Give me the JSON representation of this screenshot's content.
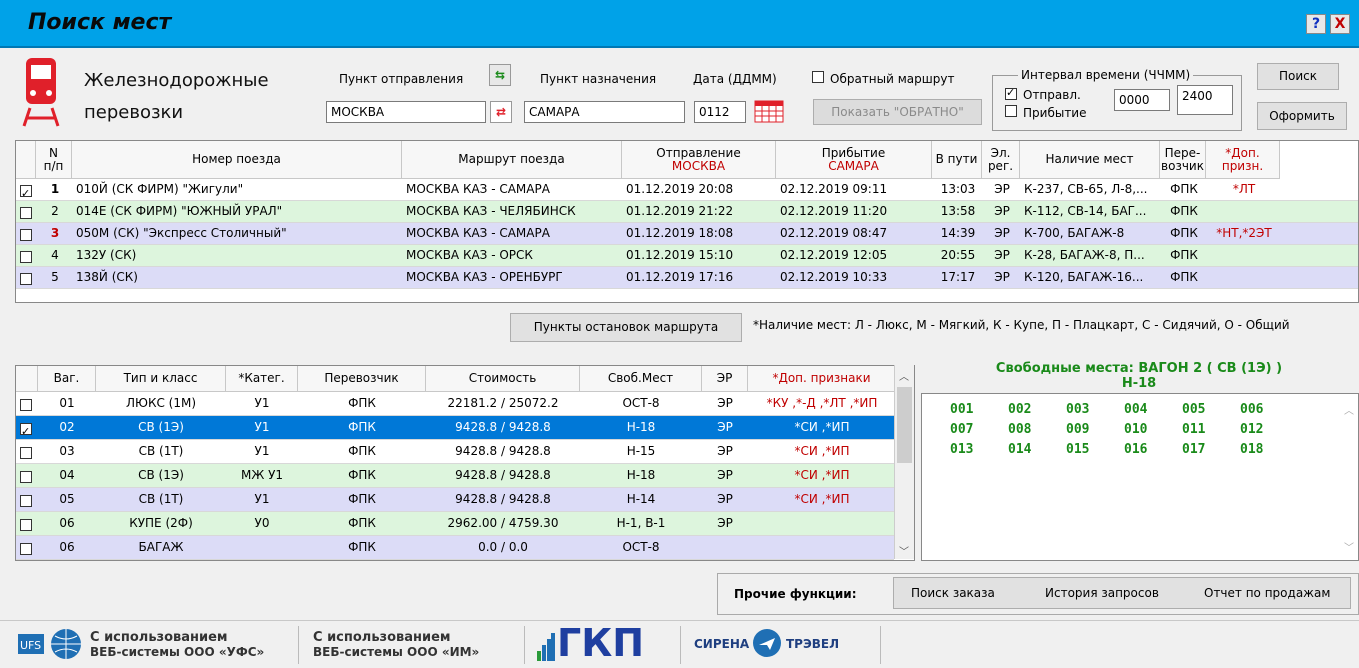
{
  "window": {
    "title": "Поиск мест",
    "help_label": "?",
    "close_label": "X"
  },
  "brand": {
    "line1": "Железнодорожные",
    "line2": "перевозки"
  },
  "search": {
    "from_label": "Пункт отправления",
    "from_value": "МОСКВА",
    "to_label": "Пункт назначения",
    "to_value": "САМАРА",
    "date_label": "Дата (ДДММ)",
    "date_value": "0112",
    "return_label": "Обратный маршрут",
    "show_return_label": "Показать \"ОБРАТНО\"",
    "interval_title": "Интервал времени (ЧЧММ)",
    "depart_label": "Отправл.",
    "arrive_label": "Прибытие",
    "time_from": "0000",
    "time_to": "2400",
    "search_button": "Поиск",
    "order_button": "Оформить"
  },
  "trains": {
    "headers": [
      {
        "l1": "N",
        "l2": "п/п"
      },
      {
        "l1": "Номер поезда",
        "l2": ""
      },
      {
        "l1": "Маршрут поезда",
        "l2": ""
      },
      {
        "l1": "Отправление",
        "l2": "МОСКВА"
      },
      {
        "l1": "Прибытие",
        "l2": "САМАРА"
      },
      {
        "l1": "В пути",
        "l2": ""
      },
      {
        "l1": "Эл.",
        "l2": "рег."
      },
      {
        "l1": "Наличие мест",
        "l2": ""
      },
      {
        "l1": "Пере-",
        "l2": "возчик"
      },
      {
        "l1": "*Доп.",
        "l2": "призн."
      }
    ],
    "rows": [
      {
        "n": "1",
        "train": "010Й  (СК ФИРМ)  \"Жигули\"",
        "route": "МОСКВА КАЗ - САМАРА",
        "dep": "01.12.2019  20:08",
        "arr": "02.12.2019  09:11",
        "dur": "13:03",
        "er": "ЭР",
        "seats": "К-237, СВ-65, Л-8,...",
        "carrier": "ФПК",
        "extra": "*ЛТ",
        "checked": true,
        "bold": true,
        "red_n": false,
        "bg": "#ffffff"
      },
      {
        "n": "2",
        "train": "014Е  (СК ФИРМ)  \"ЮЖНЫЙ УРАЛ\"",
        "route": "МОСКВА КАЗ - ЧЕЛЯБИНСК",
        "dep": "01.12.2019  21:22",
        "arr": "02.12.2019  11:20",
        "dur": "13:58",
        "er": "ЭР",
        "seats": "К-112, СВ-14, БАГ...",
        "carrier": "ФПК",
        "extra": "",
        "checked": false,
        "bold": false,
        "red_n": false,
        "bg": "#ddf5dd"
      },
      {
        "n": "3",
        "train": "050М  (СК)  \"Экспресс Столичный\"",
        "route": "МОСКВА КАЗ - САМАРА",
        "dep": "01.12.2019  18:08",
        "arr": "02.12.2019  08:47",
        "dur": "14:39",
        "er": "ЭР",
        "seats": "К-700, БАГАЖ-8",
        "carrier": "ФПК",
        "extra": "*НТ,*2ЭТ",
        "checked": false,
        "bold": true,
        "red_n": true,
        "bg": "#dcdcf7"
      },
      {
        "n": "4",
        "train": "132У  (СК)",
        "route": "МОСКВА КАЗ - ОРСК",
        "dep": "01.12.2019  15:10",
        "arr": "02.12.2019  12:05",
        "dur": "20:55",
        "er": "ЭР",
        "seats": "К-28, БАГАЖ-8, П...",
        "carrier": "ФПК",
        "extra": "",
        "checked": false,
        "bold": false,
        "red_n": false,
        "bg": "#ddf5dd"
      },
      {
        "n": "5",
        "train": "138Й  (СК)",
        "route": "МОСКВА КАЗ - ОРЕНБУРГ",
        "dep": "01.12.2019  17:16",
        "arr": "02.12.2019  10:33",
        "dur": "17:17",
        "er": "ЭР",
        "seats": "К-120, БАГАЖ-16...",
        "carrier": "ФПК",
        "extra": "",
        "checked": false,
        "bold": false,
        "red_n": false,
        "bg": "#dcdcf7"
      }
    ]
  },
  "stops_button": "Пункты остановок маршрута",
  "legend": "*Наличие мест:  Л - Люкс, М - Мягкий, К - Купе, П - Плацкарт,  С - Сидячий, О - Общий",
  "wagons": {
    "headers": [
      "Ваг.",
      "Тип и класс",
      "*Катег.",
      "Перевозчик",
      "Стоимость",
      "Своб.Мест",
      "ЭР",
      "*Доп. признаки"
    ],
    "rows": [
      {
        "num": "01",
        "type": "ЛЮКС (1М)",
        "cat": "У1",
        "carrier": "ФПК",
        "cost": "22181.2 / 25072.2",
        "free": "ОСТ-8",
        "er": "ЭР",
        "extra": "*КУ ,*-Д ,*ЛТ ,*ИП",
        "checked": false,
        "selected": false,
        "bg": "#ffffff"
      },
      {
        "num": "02",
        "type": "СВ (1Э)",
        "cat": "У1",
        "carrier": "ФПК",
        "cost": "9428.8 / 9428.8",
        "free": "Н-18",
        "er": "ЭР",
        "extra": "*СИ ,*ИП",
        "checked": true,
        "selected": true,
        "bg": "#0078d7"
      },
      {
        "num": "03",
        "type": "СВ (1Т)",
        "cat": "У1",
        "carrier": "ФПК",
        "cost": "9428.8 / 9428.8",
        "free": "Н-15",
        "er": "ЭР",
        "extra": "*СИ ,*ИП",
        "checked": false,
        "selected": false,
        "bg": "#ffffff"
      },
      {
        "num": "04",
        "type": "СВ (1Э)",
        "cat": "МЖ У1",
        "carrier": "ФПК",
        "cost": "9428.8 / 9428.8",
        "free": "Н-18",
        "er": "ЭР",
        "extra": "*СИ ,*ИП",
        "checked": false,
        "selected": false,
        "bg": "#ddf5dd"
      },
      {
        "num": "05",
        "type": "СВ (1Т)",
        "cat": "У1",
        "carrier": "ФПК",
        "cost": "9428.8 / 9428.8",
        "free": "Н-14",
        "er": "ЭР",
        "extra": "*СИ ,*ИП",
        "checked": false,
        "selected": false,
        "bg": "#dcdcf7"
      },
      {
        "num": "06",
        "type": "КУПЕ (2Ф)",
        "cat": "У0",
        "carrier": "ФПК",
        "cost": "2962.00 / 4759.30",
        "free": "Н-1, В-1",
        "er": "ЭР",
        "extra": "",
        "checked": false,
        "selected": false,
        "bg": "#ddf5dd"
      },
      {
        "num": "06",
        "type": "БАГАЖ",
        "cat": "",
        "carrier": "ФПК",
        "cost": "0.0 / 0.0",
        "free": "ОСТ-8",
        "er": "",
        "extra": "",
        "checked": false,
        "selected": false,
        "bg": "#dcdcf7"
      }
    ]
  },
  "free_seats": {
    "title_line1": "Свободные места: ВАГОН 2 ( СВ (1Э) )",
    "title_line2": "Н-18",
    "seats": [
      "001",
      "002",
      "003",
      "004",
      "005",
      "006",
      "007",
      "008",
      "009",
      "010",
      "011",
      "012",
      "013",
      "014",
      "015",
      "016",
      "017",
      "018"
    ]
  },
  "other": {
    "label": "Прочие функции:",
    "order_search": "Поиск заказа",
    "history": "История запросов",
    "sales_report": "Отчет по продажам"
  },
  "footer": {
    "ufs_line1": "С использованием",
    "ufs_line2": "ВЕБ-системы ООО «УФС»",
    "im_line1": "С использованием",
    "im_line2": "ВЕБ-системы ООО «ИМ»",
    "gkp_logo": "ГКП",
    "sirena": "СИРЕНА",
    "travel": "ТРЭВЕЛ"
  },
  "colors": {
    "titlebar": "#00a2e8",
    "green_row": "#ddf5dd",
    "blue_row": "#dcdcf7",
    "selected": "#0078d7",
    "accent_red": "#c00000",
    "seat_green": "#1a8a1a"
  }
}
